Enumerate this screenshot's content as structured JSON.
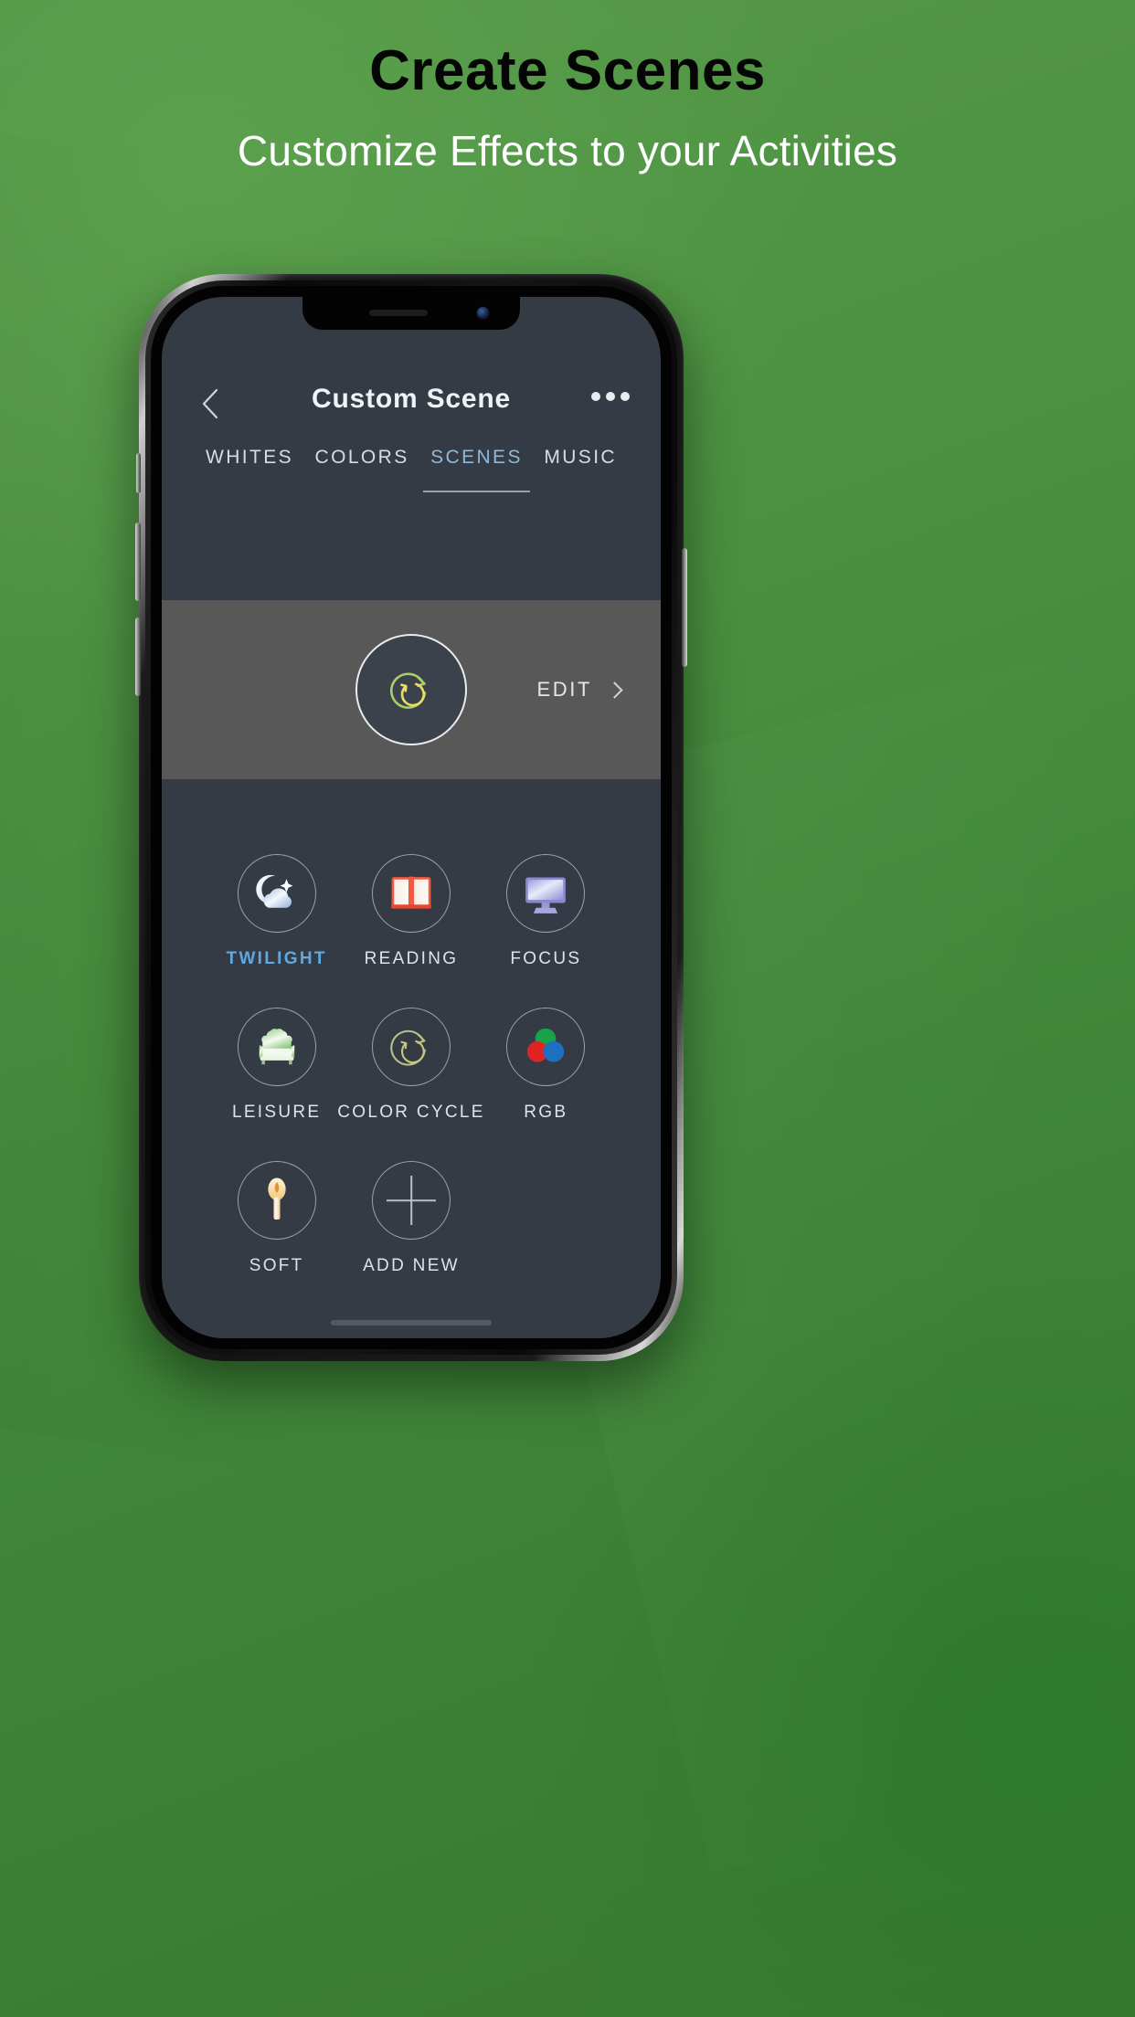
{
  "promo": {
    "title": "Create Scenes",
    "subtitle": "Customize Effects to your Activities",
    "bg_color_top": "#57994a",
    "bg_color_bottom": "#37792f",
    "title_color": "#050505",
    "subtitle_color": "#ffffff"
  },
  "app": {
    "screen_bg": "#353b44",
    "accent_color": "#8fb9d9",
    "header": {
      "back_icon": "chevron-left-icon",
      "title": "Custom Scene",
      "menu_icon": "more-horizontal-icon"
    },
    "tabs": [
      {
        "label": "WHITES",
        "active": false
      },
      {
        "label": "COLORS",
        "active": false
      },
      {
        "label": "SCENES",
        "active": true
      },
      {
        "label": "MUSIC",
        "active": false
      }
    ],
    "edit_card": {
      "icon": "color-cycle-icon",
      "icon_colors": [
        "#a9cf6a",
        "#e8df62"
      ],
      "card_bg": "#585858",
      "edit_label": "EDIT",
      "chevron_icon": "chevron-right-icon"
    },
    "scenes": [
      {
        "label": "TWILIGHT",
        "icon": "moon-cloud-icon",
        "active": true
      },
      {
        "label": "READING",
        "icon": "open-book-icon",
        "active": false
      },
      {
        "label": "FOCUS",
        "icon": "monitor-icon",
        "active": false
      },
      {
        "label": "LEISURE",
        "icon": "armchair-icon",
        "active": false
      },
      {
        "label": "COLOR CYCLE",
        "icon": "color-cycle-icon",
        "active": false
      },
      {
        "label": "RGB",
        "icon": "rgb-circles-icon",
        "active": false
      },
      {
        "label": "SOFT",
        "icon": "candle-icon",
        "active": false
      },
      {
        "label": "ADD NEW",
        "icon": "plus-icon",
        "active": false
      }
    ]
  }
}
